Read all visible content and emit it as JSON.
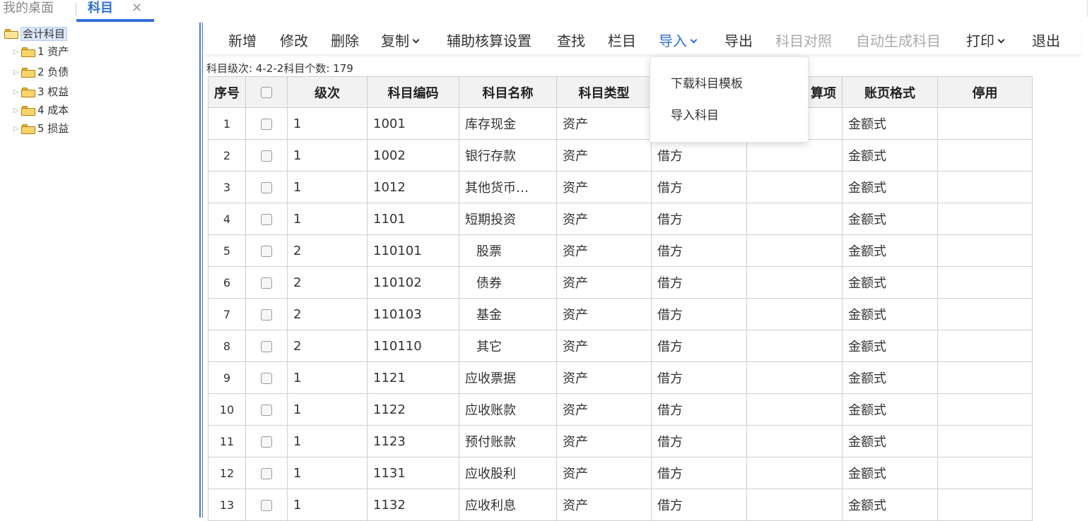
{
  "tabs": {
    "desktop": "我的桌面",
    "subjects": "科目",
    "close": "✕"
  },
  "tree": {
    "root": "会计科目",
    "items": [
      {
        "label": "1 资产"
      },
      {
        "label": "2 负债"
      },
      {
        "label": "3 权益"
      },
      {
        "label": "4 成本"
      },
      {
        "label": "5 损益"
      }
    ]
  },
  "toolbar": {
    "add": "新增",
    "edit": "修改",
    "delete": "删除",
    "copy": "复制",
    "aux_settings": "辅助核算设置",
    "find": "查找",
    "columns": "栏目",
    "import": "导入",
    "export": "导出",
    "mapping": "科目对照",
    "auto_generate": "自动生成科目",
    "print": "打印",
    "exit": "退出"
  },
  "info": {
    "level_label": "科目级次:",
    "level_value": "4-2-2",
    "count_label": "科目个数:",
    "count_value": "179"
  },
  "table": {
    "headers": {
      "seq": "序号",
      "level": "级次",
      "code": "科目编码",
      "name": "科目名称",
      "type": "科目类型",
      "direction": "",
      "aux": "算项",
      "format": "账页格式",
      "disabled": "停用"
    },
    "rows": [
      {
        "seq": "1",
        "level": "1",
        "code": "1001",
        "name": "库存现金",
        "type": "资产",
        "direction": "",
        "aux": "",
        "format": "金额式",
        "disabled": ""
      },
      {
        "seq": "2",
        "level": "1",
        "code": "1002",
        "name": "银行存款",
        "type": "资产",
        "direction": "借方",
        "aux": "",
        "format": "金额式",
        "disabled": ""
      },
      {
        "seq": "3",
        "level": "1",
        "code": "1012",
        "name": "其他货币…",
        "type": "资产",
        "direction": "借方",
        "aux": "",
        "format": "金额式",
        "disabled": ""
      },
      {
        "seq": "4",
        "level": "1",
        "code": "1101",
        "name": "短期投资",
        "type": "资产",
        "direction": "借方",
        "aux": "",
        "format": "金额式",
        "disabled": ""
      },
      {
        "seq": "5",
        "level": "2",
        "code": "110101",
        "name": "股票",
        "type": "资产",
        "direction": "借方",
        "aux": "",
        "format": "金额式",
        "disabled": ""
      },
      {
        "seq": "6",
        "level": "2",
        "code": "110102",
        "name": "债券",
        "type": "资产",
        "direction": "借方",
        "aux": "",
        "format": "金额式",
        "disabled": ""
      },
      {
        "seq": "7",
        "level": "2",
        "code": "110103",
        "name": "基金",
        "type": "资产",
        "direction": "借方",
        "aux": "",
        "format": "金额式",
        "disabled": ""
      },
      {
        "seq": "8",
        "level": "2",
        "code": "110110",
        "name": "其它",
        "type": "资产",
        "direction": "借方",
        "aux": "",
        "format": "金额式",
        "disabled": ""
      },
      {
        "seq": "9",
        "level": "1",
        "code": "1121",
        "name": "应收票据",
        "type": "资产",
        "direction": "借方",
        "aux": "",
        "format": "金额式",
        "disabled": ""
      },
      {
        "seq": "10",
        "level": "1",
        "code": "1122",
        "name": "应收账款",
        "type": "资产",
        "direction": "借方",
        "aux": "",
        "format": "金额式",
        "disabled": ""
      },
      {
        "seq": "11",
        "level": "1",
        "code": "1123",
        "name": "预付账款",
        "type": "资产",
        "direction": "借方",
        "aux": "",
        "format": "金额式",
        "disabled": ""
      },
      {
        "seq": "12",
        "level": "1",
        "code": "1131",
        "name": "应收股利",
        "type": "资产",
        "direction": "借方",
        "aux": "",
        "format": "金额式",
        "disabled": ""
      },
      {
        "seq": "13",
        "level": "1",
        "code": "1132",
        "name": "应收利息",
        "type": "资产",
        "direction": "借方",
        "aux": "",
        "format": "金额式",
        "disabled": ""
      }
    ]
  },
  "import_menu": {
    "download_template": "下载科目模板",
    "import_subjects": "导入科目"
  },
  "colors": {
    "accent": "#2f6fd8",
    "header_bg": "#f2f2f2",
    "disabled_text": "#aaaaaa"
  }
}
